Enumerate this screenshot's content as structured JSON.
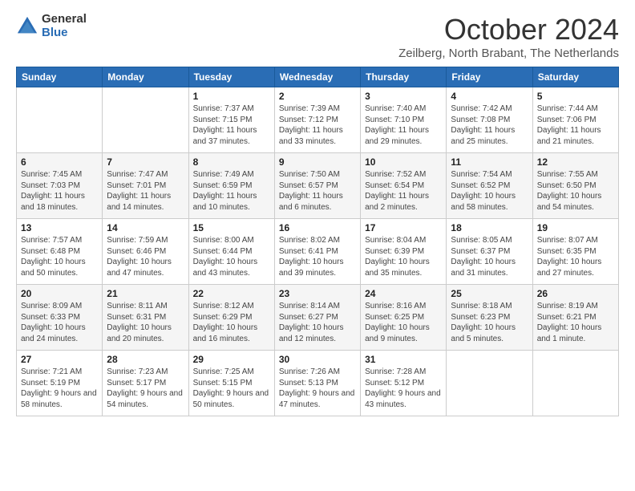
{
  "header": {
    "logo_general": "General",
    "logo_blue": "Blue",
    "month_title": "October 2024",
    "subtitle": "Zeilberg, North Brabant, The Netherlands"
  },
  "days_of_week": [
    "Sunday",
    "Monday",
    "Tuesday",
    "Wednesday",
    "Thursday",
    "Friday",
    "Saturday"
  ],
  "weeks": [
    [
      {
        "day": "",
        "info": ""
      },
      {
        "day": "",
        "info": ""
      },
      {
        "day": "1",
        "info": "Sunrise: 7:37 AM\nSunset: 7:15 PM\nDaylight: 11 hours and 37 minutes."
      },
      {
        "day": "2",
        "info": "Sunrise: 7:39 AM\nSunset: 7:12 PM\nDaylight: 11 hours and 33 minutes."
      },
      {
        "day": "3",
        "info": "Sunrise: 7:40 AM\nSunset: 7:10 PM\nDaylight: 11 hours and 29 minutes."
      },
      {
        "day": "4",
        "info": "Sunrise: 7:42 AM\nSunset: 7:08 PM\nDaylight: 11 hours and 25 minutes."
      },
      {
        "day": "5",
        "info": "Sunrise: 7:44 AM\nSunset: 7:06 PM\nDaylight: 11 hours and 21 minutes."
      }
    ],
    [
      {
        "day": "6",
        "info": "Sunrise: 7:45 AM\nSunset: 7:03 PM\nDaylight: 11 hours and 18 minutes."
      },
      {
        "day": "7",
        "info": "Sunrise: 7:47 AM\nSunset: 7:01 PM\nDaylight: 11 hours and 14 minutes."
      },
      {
        "day": "8",
        "info": "Sunrise: 7:49 AM\nSunset: 6:59 PM\nDaylight: 11 hours and 10 minutes."
      },
      {
        "day": "9",
        "info": "Sunrise: 7:50 AM\nSunset: 6:57 PM\nDaylight: 11 hours and 6 minutes."
      },
      {
        "day": "10",
        "info": "Sunrise: 7:52 AM\nSunset: 6:54 PM\nDaylight: 11 hours and 2 minutes."
      },
      {
        "day": "11",
        "info": "Sunrise: 7:54 AM\nSunset: 6:52 PM\nDaylight: 10 hours and 58 minutes."
      },
      {
        "day": "12",
        "info": "Sunrise: 7:55 AM\nSunset: 6:50 PM\nDaylight: 10 hours and 54 minutes."
      }
    ],
    [
      {
        "day": "13",
        "info": "Sunrise: 7:57 AM\nSunset: 6:48 PM\nDaylight: 10 hours and 50 minutes."
      },
      {
        "day": "14",
        "info": "Sunrise: 7:59 AM\nSunset: 6:46 PM\nDaylight: 10 hours and 47 minutes."
      },
      {
        "day": "15",
        "info": "Sunrise: 8:00 AM\nSunset: 6:44 PM\nDaylight: 10 hours and 43 minutes."
      },
      {
        "day": "16",
        "info": "Sunrise: 8:02 AM\nSunset: 6:41 PM\nDaylight: 10 hours and 39 minutes."
      },
      {
        "day": "17",
        "info": "Sunrise: 8:04 AM\nSunset: 6:39 PM\nDaylight: 10 hours and 35 minutes."
      },
      {
        "day": "18",
        "info": "Sunrise: 8:05 AM\nSunset: 6:37 PM\nDaylight: 10 hours and 31 minutes."
      },
      {
        "day": "19",
        "info": "Sunrise: 8:07 AM\nSunset: 6:35 PM\nDaylight: 10 hours and 27 minutes."
      }
    ],
    [
      {
        "day": "20",
        "info": "Sunrise: 8:09 AM\nSunset: 6:33 PM\nDaylight: 10 hours and 24 minutes."
      },
      {
        "day": "21",
        "info": "Sunrise: 8:11 AM\nSunset: 6:31 PM\nDaylight: 10 hours and 20 minutes."
      },
      {
        "day": "22",
        "info": "Sunrise: 8:12 AM\nSunset: 6:29 PM\nDaylight: 10 hours and 16 minutes."
      },
      {
        "day": "23",
        "info": "Sunrise: 8:14 AM\nSunset: 6:27 PM\nDaylight: 10 hours and 12 minutes."
      },
      {
        "day": "24",
        "info": "Sunrise: 8:16 AM\nSunset: 6:25 PM\nDaylight: 10 hours and 9 minutes."
      },
      {
        "day": "25",
        "info": "Sunrise: 8:18 AM\nSunset: 6:23 PM\nDaylight: 10 hours and 5 minutes."
      },
      {
        "day": "26",
        "info": "Sunrise: 8:19 AM\nSunset: 6:21 PM\nDaylight: 10 hours and 1 minute."
      }
    ],
    [
      {
        "day": "27",
        "info": "Sunrise: 7:21 AM\nSunset: 5:19 PM\nDaylight: 9 hours and 58 minutes."
      },
      {
        "day": "28",
        "info": "Sunrise: 7:23 AM\nSunset: 5:17 PM\nDaylight: 9 hours and 54 minutes."
      },
      {
        "day": "29",
        "info": "Sunrise: 7:25 AM\nSunset: 5:15 PM\nDaylight: 9 hours and 50 minutes."
      },
      {
        "day": "30",
        "info": "Sunrise: 7:26 AM\nSunset: 5:13 PM\nDaylight: 9 hours and 47 minutes."
      },
      {
        "day": "31",
        "info": "Sunrise: 7:28 AM\nSunset: 5:12 PM\nDaylight: 9 hours and 43 minutes."
      },
      {
        "day": "",
        "info": ""
      },
      {
        "day": "",
        "info": ""
      }
    ]
  ]
}
